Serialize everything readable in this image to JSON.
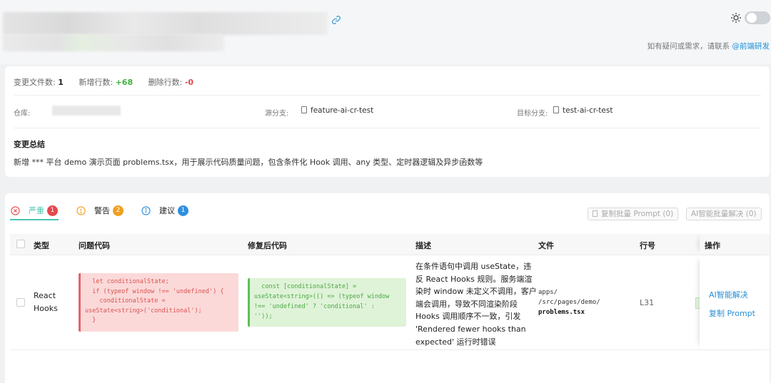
{
  "header": {
    "contact_text": "如有疑问或需求，请联系 ",
    "contact_link": "@前端研发"
  },
  "stats": {
    "changed_files_label": "变更文件数:",
    "changed_files_value": "1",
    "added_lines_label": "新增行数:",
    "added_lines_value": "+68",
    "deleted_lines_label": "删除行数:",
    "deleted_lines_value": "-0"
  },
  "repo": {
    "repo_label": "仓库:",
    "source_label": "源分支:",
    "source_branch": "feature-ai-cr-test",
    "target_label": "目标分支:",
    "target_branch": "test-ai-cr-test"
  },
  "summary": {
    "title": "变更总结",
    "text": "新增 *** 平台 demo 演示页面 problems.tsx，用于展示代码质量问题，包含条件化 Hook 调用、any 类型、定时器逻辑及异步函数等"
  },
  "tabs": [
    {
      "label": "严重",
      "count": "1",
      "color": "#e5484d"
    },
    {
      "label": "警告",
      "count": "2",
      "color": "#f0a020"
    },
    {
      "label": "建议",
      "count": "1",
      "color": "#2f8fe0"
    }
  ],
  "bulk": {
    "copy_prompt": "复制批量 Prompt (0)",
    "ai_resolve": "AI智能批量解决 (0)"
  },
  "table": {
    "headers": {
      "type": "类型",
      "problem_code": "问题代码",
      "fixed_code": "修复后代码",
      "description": "描述",
      "file": "文件",
      "line": "行号",
      "action": "操作"
    },
    "rows": [
      {
        "type": "React Hooks",
        "problem_code": "  let conditionalState;\n  if (typeof window !== 'undefined') {\n    conditionalState =\nuseState<string>('conditional');\n  }",
        "fixed_code": "  const [conditionalState] =\nuseState<string>(() => (typeof window\n!== 'undefined' ? 'conditional' :\n''));",
        "description": "在条件语句中调用 useState，违反 React Hooks 规则。服务端渲染时 window 未定义不调用，客户端会调用，导致不同渲染阶段 Hooks 调用顺序不一致，引发 'Rendered fewer hooks than expected' 运行时错误",
        "file_path": "apps/\n/src/pages/demo/",
        "file_name": "problems.tsx",
        "line": "L31",
        "action_resolve": "AI智能解决",
        "action_copy": "复制 Prompt"
      }
    ]
  }
}
